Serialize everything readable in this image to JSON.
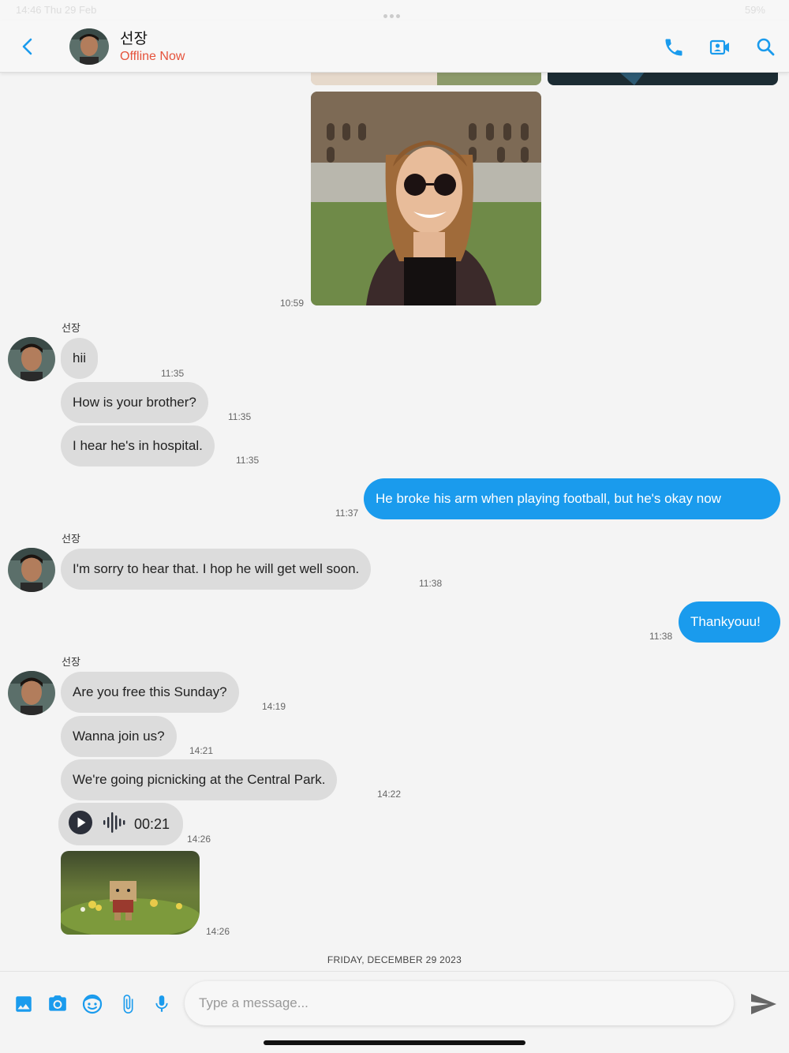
{
  "status_bar": {
    "left_text": "14:46  Thu 29 Feb",
    "right_text": "59%"
  },
  "header": {
    "contact_name": "선장",
    "contact_status": "Offline Now",
    "icons": [
      "back-icon",
      "phone-icon",
      "video-call-icon",
      "search-icon"
    ]
  },
  "chat": {
    "photo_time": "10:59",
    "group1": {
      "sender": "선장",
      "messages": [
        {
          "text": "hii",
          "time": "11:35"
        },
        {
          "text": "How is your brother?",
          "time": "11:35"
        },
        {
          "text": "I hear he's in hospital.",
          "time": "11:35"
        }
      ]
    },
    "out1": {
      "text": "He broke his arm when playing football, but he's okay now",
      "time": "11:37"
    },
    "group2": {
      "sender": "선장",
      "messages": [
        {
          "text": "I'm sorry to hear that. I hop he will get well soon.",
          "time": "11:38"
        }
      ]
    },
    "out2": {
      "text": "Thankyouu!",
      "time": "11:38"
    },
    "group3": {
      "sender": "선장",
      "messages": [
        {
          "text": "Are you free this Sunday?",
          "time": "14:19"
        },
        {
          "text": "Wanna join us?",
          "time": "14:21"
        },
        {
          "text": "We're going picnicking at the Central Park.",
          "time": "14:22"
        }
      ],
      "voice": {
        "duration": "00:21",
        "time": "14:26"
      },
      "image_time": "14:26"
    },
    "date_separator": "FRIDAY, DECEMBER 29 2023"
  },
  "composer": {
    "placeholder": "Type a message...",
    "icons": [
      "gallery-icon",
      "camera-icon",
      "emoji-icon",
      "attachment-icon",
      "microphone-icon",
      "send-icon"
    ]
  },
  "colors": {
    "accent": "#1a9bed",
    "incoming_bubble": "#dcdcdc",
    "offline": "#e5533c"
  }
}
